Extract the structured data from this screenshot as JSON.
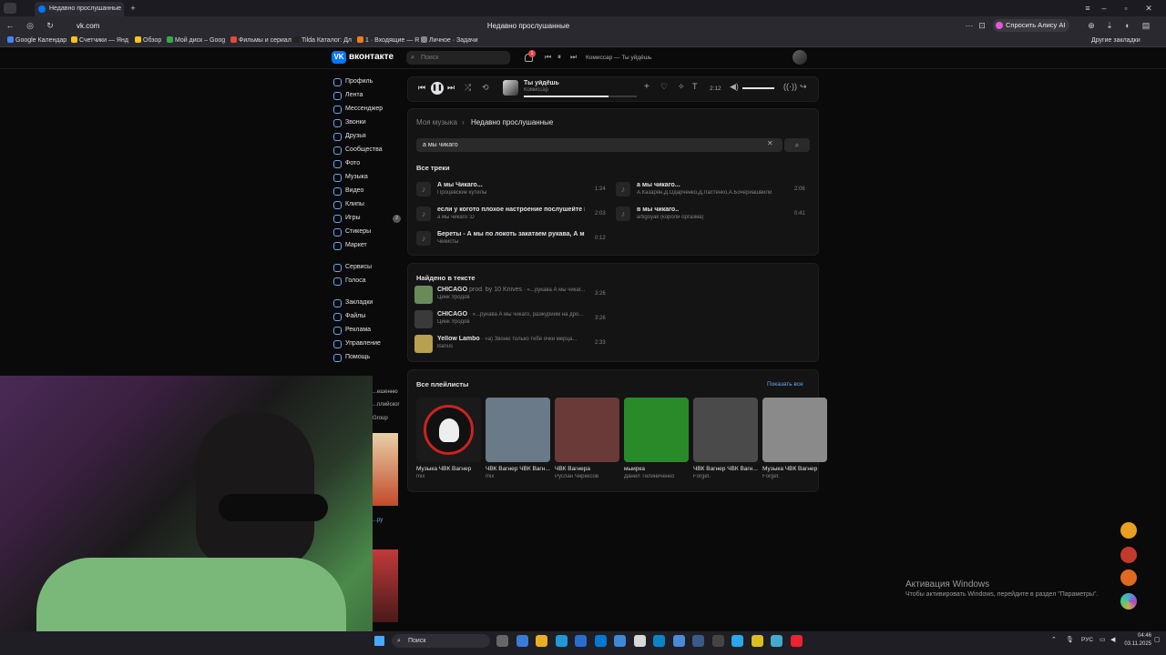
{
  "browser": {
    "tab_title": "Недавно прослушанные",
    "url": "vk.com",
    "page_title": "Недавно прослушанные",
    "alice_button": "Спросить Алису AI",
    "other_bookmarks": "Другие закладки",
    "bookmarks": [
      "Google Календар",
      "Счетчики — Янд",
      "Обзор",
      "Мой диск – Goog",
      "Фильмы и сериал",
      "Tilda Каталог: Дл",
      "1 · Входящие — R",
      "Личное · Задачи"
    ]
  },
  "vk": {
    "logo_text": "вконтакте",
    "search_placeholder": "Поиск",
    "notif_count": "1",
    "header_track": "Комиссар — Ты уйдёшь",
    "nav": [
      "Профиль",
      "Лента",
      "Мессенджер",
      "Звонки",
      "Друзья",
      "Сообщества",
      "Фото",
      "Музыка",
      "Видео",
      "Клипы",
      "Игры",
      "Стикеры",
      "Маркет"
    ],
    "nav2": [
      "Сервисы",
      "Голоса"
    ],
    "nav3": [
      "Закладки",
      "Файлы",
      "Реклама",
      "Управление",
      "Помощь"
    ],
    "games_badge": "2"
  },
  "player": {
    "title": "Ты уйдёшь",
    "artist": "Комиссар",
    "time": "2:12"
  },
  "music": {
    "breadcrumb_root": "Моя музыка",
    "breadcrumb_current": "Недавно прослушанные",
    "query": "а мы чикаго",
    "all_tracks_title": "Все треки",
    "tracks": [
      {
        "title": "А мы Чикаго...",
        "artist": "Процевские кутилы",
        "duration": "1:24"
      },
      {
        "title": "а мы чикаго...",
        "artist": "А.Казарян,Д.Одарченко,Д.Ластенко,А.Бочериашвили",
        "duration": "2:06"
      },
      {
        "title": "если у когото плохое настроение послушейте это п...",
        "artist": "а мы чикаго :D",
        "duration": "2:03"
      },
      {
        "title": "в мы чикаго..",
        "artist": "artigoyak (короли оргазма)",
        "duration": "0:41"
      },
      {
        "title": "Береты - А мы по локоть закатаем рукава, А мы Чи...",
        "artist": "Чекисты",
        "duration": "0:12"
      }
    ],
    "found_title": "Найдено в тексте",
    "found": [
      {
        "title": "CHICAGO",
        "extra": "prod. by 10 Knives",
        "snippet": "· «...рукава А мы чикаг...",
        "artist": "Цинк Уродов",
        "duration": "3:26"
      },
      {
        "title": "CHICAGO",
        "extra": "",
        "snippet": "· «...рукава А мы чикаго, разжуриим на дро...",
        "artist": "Цинк Уродов",
        "duration": "3:26"
      },
      {
        "title": "Yellow Lambo",
        "extra": "",
        "snippet": "· «а) Звоню только тебе очки мерца...",
        "artist": "Barius",
        "duration": "2:33"
      }
    ],
    "playlists_title": "Все плейлисты",
    "show_all": "Показать все",
    "playlists": [
      {
        "title": "Музыка ЧВК Вагнер",
        "sub": "mix",
        "color": "#1a1a1a"
      },
      {
        "title": "ЧВК Вагнер ЧВК Вагн...",
        "sub": "mix",
        "color": "#6a7a88"
      },
      {
        "title": "ЧВК Вагнера",
        "sub": "Руслан Чиркесов",
        "color": "#6a3a38"
      },
      {
        "title": "мыирка",
        "sub": "Данил Тилиниченко",
        "color": "#2a8a2a"
      },
      {
        "title": "ЧВК Вагнер ЧВК Вагн...",
        "sub": "Forget.",
        "color": "#4a4a4a"
      },
      {
        "title": "Музыка ЧВК Вагнер",
        "sub": "Forget.",
        "color": "#8a8a8a"
      }
    ],
    "cover1_text": "PMC Wagner Group"
  },
  "windows": {
    "activation_title": "Активация Windows",
    "activation_text": "Чтобы активировать Windows, перейдите в раздел \"Параметры\".",
    "search_label": "Поиск",
    "lang": "РУС",
    "time": "04:46",
    "date": "03.11.2025"
  },
  "sidebar_peek": [
    "...ешенню",
    "...плийског",
    "Group",
    "...ру"
  ]
}
